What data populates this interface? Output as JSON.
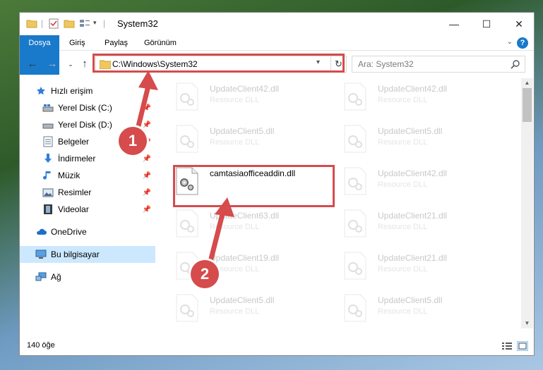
{
  "window": {
    "title": "System32",
    "controls": {
      "minimize": "—",
      "maximize": "☐",
      "close": "✕"
    }
  },
  "ribbon": {
    "tabs": [
      "Dosya",
      "Giriş",
      "Paylaş",
      "Görünüm"
    ],
    "help": "?"
  },
  "address": {
    "path": "C:\\Windows\\System32",
    "search_placeholder": "Ara: System32"
  },
  "sidebar": {
    "items": [
      {
        "label": "Hızlı erişim",
        "icon": "star-icon"
      },
      {
        "label": "Yerel Disk (C:)",
        "icon": "drive-icon",
        "pinned": true
      },
      {
        "label": "Yerel Disk (D:)",
        "icon": "drive-icon",
        "pinned": true
      },
      {
        "label": "Belgeler",
        "icon": "documents-icon",
        "pinned": true
      },
      {
        "label": "İndirmeler",
        "icon": "download-icon",
        "pinned": true
      },
      {
        "label": "Müzik",
        "icon": "music-icon",
        "pinned": true
      },
      {
        "label": "Resimler",
        "icon": "pictures-icon",
        "pinned": true
      },
      {
        "label": "Videolar",
        "icon": "videos-icon",
        "pinned": true
      },
      {
        "label": "OneDrive",
        "icon": "cloud-icon"
      },
      {
        "label": "Bu bilgisayar",
        "icon": "computer-icon",
        "selected": true
      },
      {
        "label": "Ağ",
        "icon": "network-icon"
      }
    ]
  },
  "files": {
    "left": [
      {
        "name": "UpdateClient42.dll",
        "type": "Resource DLL"
      },
      {
        "name": "UpdateClient5.dll",
        "type": "Resource DLL"
      },
      {
        "name": "camtasiaofficeaddin.dll",
        "type": ""
      },
      {
        "name": "UpdateClient63.dll",
        "type": "Resource DLL"
      },
      {
        "name": "UpdateClient19.dll",
        "type": "Resource DLL"
      },
      {
        "name": "UpdateClient5.dll",
        "type": "Resource DLL"
      }
    ],
    "right": [
      {
        "name": "UpdateClient42.dll",
        "type": "Resource DLL"
      },
      {
        "name": "UpdateClient5.dll",
        "type": "Resource DLL"
      },
      {
        "name": "UpdateClient42.dll",
        "type": "Resource DLL"
      },
      {
        "name": "UpdateClient21.dll",
        "type": "Resource DLL"
      },
      {
        "name": "UpdateClient21.dll",
        "type": "Resource DLL"
      },
      {
        "name": "UpdateClient5.dll",
        "type": "Resource DLL"
      }
    ]
  },
  "status": {
    "count": "140 öğe"
  },
  "annotations": {
    "step1": "1",
    "step2": "2",
    "color": "#d64b4b"
  }
}
